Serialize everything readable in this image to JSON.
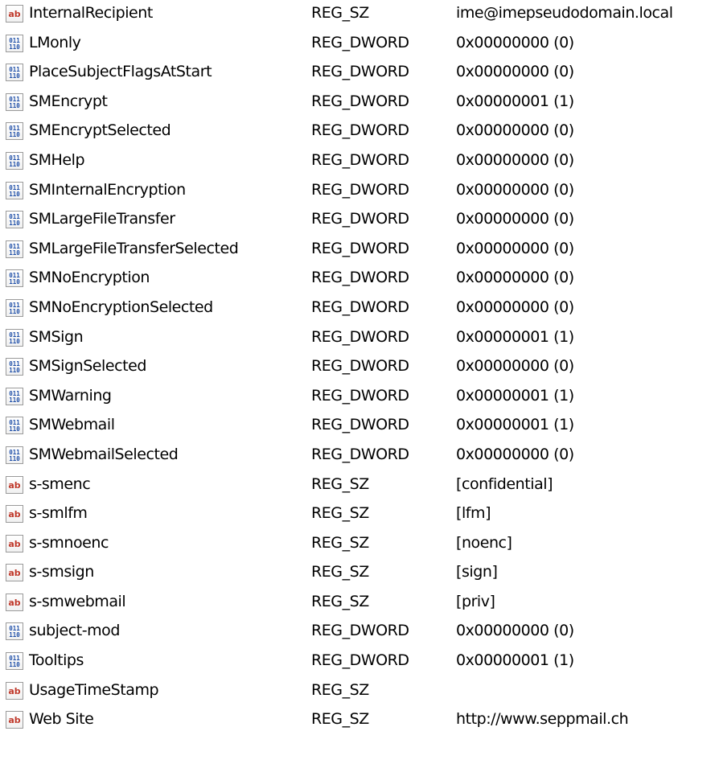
{
  "values": [
    {
      "name": "InternalRecipient",
      "type": "REG_SZ",
      "data": "ime@imepseudodomain.local",
      "icon": "string-value-icon"
    },
    {
      "name": "LMonly",
      "type": "REG_DWORD",
      "data": "0x00000000 (0)",
      "icon": "binary-value-icon"
    },
    {
      "name": "PlaceSubjectFlagsAtStart",
      "type": "REG_DWORD",
      "data": "0x00000000 (0)",
      "icon": "binary-value-icon"
    },
    {
      "name": "SMEncrypt",
      "type": "REG_DWORD",
      "data": "0x00000001 (1)",
      "icon": "binary-value-icon"
    },
    {
      "name": "SMEncryptSelected",
      "type": "REG_DWORD",
      "data": "0x00000000 (0)",
      "icon": "binary-value-icon"
    },
    {
      "name": "SMHelp",
      "type": "REG_DWORD",
      "data": "0x00000000 (0)",
      "icon": "binary-value-icon"
    },
    {
      "name": "SMInternalEncryption",
      "type": "REG_DWORD",
      "data": "0x00000000 (0)",
      "icon": "binary-value-icon"
    },
    {
      "name": "SMLargeFileTransfer",
      "type": "REG_DWORD",
      "data": "0x00000000 (0)",
      "icon": "binary-value-icon"
    },
    {
      "name": "SMLargeFileTransferSelected",
      "type": "REG_DWORD",
      "data": "0x00000000 (0)",
      "icon": "binary-value-icon"
    },
    {
      "name": "SMNoEncryption",
      "type": "REG_DWORD",
      "data": "0x00000000 (0)",
      "icon": "binary-value-icon"
    },
    {
      "name": "SMNoEncryptionSelected",
      "type": "REG_DWORD",
      "data": "0x00000000 (0)",
      "icon": "binary-value-icon"
    },
    {
      "name": "SMSign",
      "type": "REG_DWORD",
      "data": "0x00000001 (1)",
      "icon": "binary-value-icon"
    },
    {
      "name": "SMSignSelected",
      "type": "REG_DWORD",
      "data": "0x00000000 (0)",
      "icon": "binary-value-icon"
    },
    {
      "name": "SMWarning",
      "type": "REG_DWORD",
      "data": "0x00000001 (1)",
      "icon": "binary-value-icon"
    },
    {
      "name": "SMWebmail",
      "type": "REG_DWORD",
      "data": "0x00000001 (1)",
      "icon": "binary-value-icon"
    },
    {
      "name": "SMWebmailSelected",
      "type": "REG_DWORD",
      "data": "0x00000000 (0)",
      "icon": "binary-value-icon"
    },
    {
      "name": "s-smenc",
      "type": "REG_SZ",
      "data": "[confidential]",
      "icon": "string-value-icon"
    },
    {
      "name": "s-smlfm",
      "type": "REG_SZ",
      "data": "[lfm]",
      "icon": "string-value-icon"
    },
    {
      "name": "s-smnoenc",
      "type": "REG_SZ",
      "data": "[noenc]",
      "icon": "string-value-icon"
    },
    {
      "name": "s-smsign",
      "type": "REG_SZ",
      "data": "[sign]",
      "icon": "string-value-icon"
    },
    {
      "name": "s-smwebmail",
      "type": "REG_SZ",
      "data": "[priv]",
      "icon": "string-value-icon"
    },
    {
      "name": "subject-mod",
      "type": "REG_DWORD",
      "data": "0x00000000 (0)",
      "icon": "binary-value-icon"
    },
    {
      "name": "Tooltips",
      "type": "REG_DWORD",
      "data": "0x00000001 (1)",
      "icon": "binary-value-icon"
    },
    {
      "name": "UsageTimeStamp",
      "type": "REG_SZ",
      "data": "",
      "icon": "string-value-icon"
    },
    {
      "name": "Web Site",
      "type": "REG_SZ",
      "data": "http://www.seppmail.ch",
      "icon": "string-value-icon"
    }
  ],
  "icon_labels": {
    "string": "ab",
    "binary_top": "011",
    "binary_bottom": "110"
  },
  "colors": {
    "string_icon_text": "#c0392b",
    "binary_icon_text": "#1f4fa8"
  }
}
